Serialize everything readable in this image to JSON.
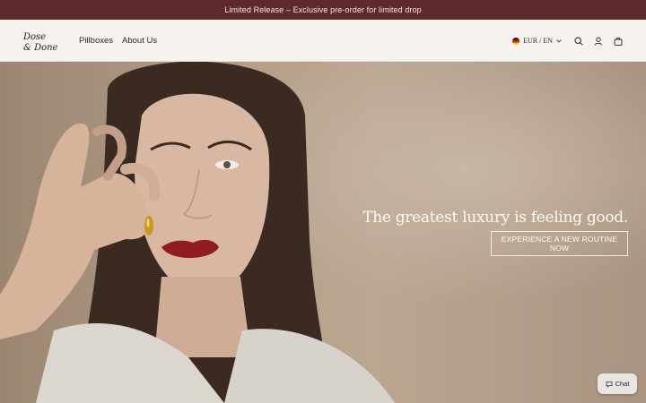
{
  "announcement": "Limited Release – Exclusive pre-order for limited drop",
  "brand": {
    "logo_text_line1": "Dose",
    "logo_text_line2": "& Done"
  },
  "nav": [
    {
      "label": "Pillboxes"
    },
    {
      "label": "About Us"
    }
  ],
  "locale": {
    "label": "EUR / EN"
  },
  "hero": {
    "tagline": "The greatest luxury is feeling good.",
    "cta": "EXPERIENCE A NEW ROUTINE NOW"
  },
  "chat": {
    "label": "Chat"
  },
  "colors": {
    "announcement_bg": "#5e2a2e",
    "header_bg": "#f6f2ee",
    "lips": "#8f1c22"
  },
  "icons": [
    "chevron-down-icon",
    "search-icon",
    "account-icon",
    "bag-icon",
    "chat-bubble-icon",
    "flag-de-icon"
  ]
}
